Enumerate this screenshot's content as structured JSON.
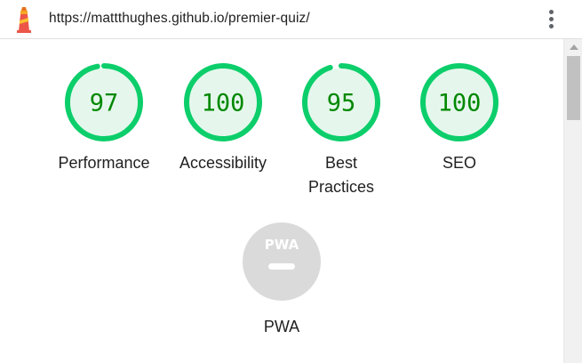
{
  "header": {
    "url": "https://mattthughes.github.io/premier-quiz/",
    "logo_icon": "lighthouse-icon",
    "menu_icon": "more-vert-icon"
  },
  "colors": {
    "pass_green": "#0cce6b",
    "pass_fill": "#e5f7ec",
    "score_text": "#008800",
    "pwa_gray": "#dadada"
  },
  "categories": [
    {
      "label": "Performance",
      "score": "97"
    },
    {
      "label": "Accessibility",
      "score": "100"
    },
    {
      "label": "Best Practices",
      "score": "95"
    },
    {
      "label": "SEO",
      "score": "100"
    }
  ],
  "pwa": {
    "badge_text": "PWA",
    "label": "PWA"
  }
}
